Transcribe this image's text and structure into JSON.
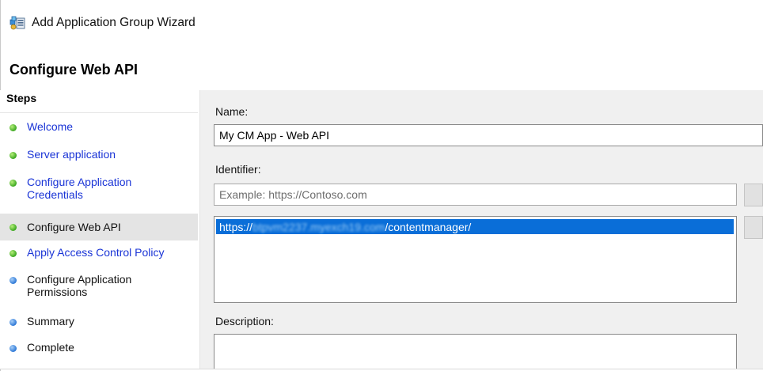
{
  "window": {
    "title": "Add Application Group Wizard"
  },
  "page": {
    "title": "Configure Web API"
  },
  "sidebar": {
    "header": "Steps",
    "items": [
      {
        "label": "Welcome",
        "status": "done",
        "style": "link"
      },
      {
        "label": "Server application",
        "status": "done",
        "style": "link"
      },
      {
        "label": "Configure Application Credentials",
        "status": "done",
        "style": "link"
      },
      {
        "label": "Configure Web API",
        "status": "done",
        "style": "current"
      },
      {
        "label": "Apply Access Control Policy",
        "status": "done",
        "style": "link"
      },
      {
        "label": "Configure Application Permissions",
        "status": "pending",
        "style": "plain"
      },
      {
        "label": "Summary",
        "status": "pending",
        "style": "plain"
      },
      {
        "label": "Complete",
        "status": "pending",
        "style": "plain"
      }
    ]
  },
  "form": {
    "name_label": "Name:",
    "name_value": "My CM App - Web API",
    "identifier_label": "Identifier:",
    "identifier_placeholder": "Example: https://Contoso.com",
    "identifiers": [
      {
        "prefix": "https://",
        "blurred": "btpvm2237.myexch19.com",
        "suffix": "/contentmanager/"
      }
    ],
    "description_label": "Description:",
    "description_value": ""
  },
  "icons": {
    "app": "application-group-icon",
    "done": "green-dot-icon",
    "pending": "blue-dot-icon"
  },
  "colors": {
    "link": "#1a34d6",
    "selection": "#0a6ed8",
    "content_bg": "#f0f0f0",
    "done": "#3aa71f",
    "pending": "#2d78d6"
  }
}
